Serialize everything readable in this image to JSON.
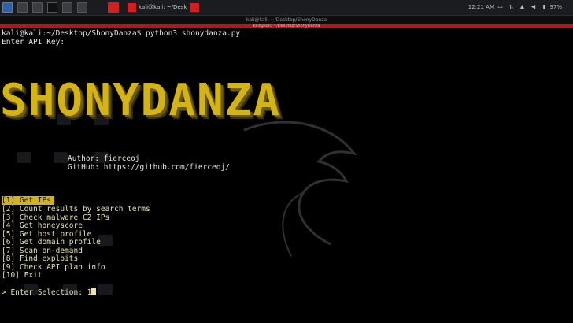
{
  "taskbar": {
    "tasks": [
      {
        "label": "kali@kali: ~/Desktop/Sh..."
      },
      {
        "label": ""
      }
    ],
    "clock": "12:21 AM",
    "battery": "97%"
  },
  "terminal": {
    "window_title": "kali@kali: ~/Desktop/ShonyDanza",
    "tab_title": "kali@kali: ~/Desktop/ShonyDanza",
    "command_line": "kali@kali:~/Desktop/ShonyDanza$ python3 shonydanza.py",
    "api_prompt": "Enter API Key:",
    "banner": "SHONYDANZA",
    "author": "Author: fierceoj",
    "github": "GitHub: https://github.com/fierceoj/",
    "menu": [
      "[1] Get IPs",
      "[2] Count results by search terms",
      "[3] Check malware C2 IPs",
      "[4] Get honeyscore",
      "[5] Get host profile",
      "[6] Get domain profile",
      "[7] Scan on-demand",
      "[8] Find exploits",
      "[9] Check API plan info",
      "[10] Exit"
    ],
    "selected_index": 0,
    "selection_prompt": "> Enter Selection: ",
    "selection_value": "1"
  },
  "colors": {
    "banner": "#d4b317",
    "menu_text": "#e9e3a8",
    "highlight": "#d4b317",
    "accent_red": "#d21f1f"
  }
}
